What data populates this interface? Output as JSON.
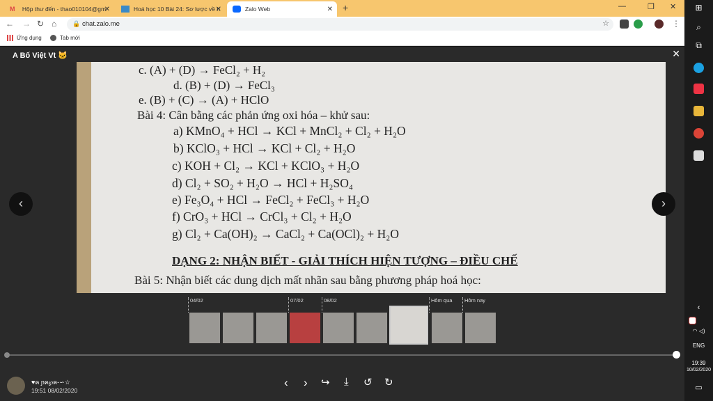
{
  "browser": {
    "tabs": [
      {
        "title": "Hộp thư đến - thao010104@gm:",
        "favicon": "gmail-icon"
      },
      {
        "title": "Hoá học 10 Bài 24: Sơ lược về hợ",
        "favicon": "edu-icon"
      },
      {
        "title": "Zalo Web",
        "favicon": "zalo-icon"
      }
    ],
    "url": "chat.zalo.me",
    "bookmarks": [
      {
        "label": "Ứng dụng",
        "icon": "apps-grid-icon"
      },
      {
        "label": "Tab mới",
        "icon": "globe-icon"
      }
    ]
  },
  "viewer": {
    "title": "A Bố Việt Vt 🐱",
    "photo_lines": [
      "c. (A) + (D) → FeCl₂ + H₂",
      "d. (B) + (D) → FeCl₃",
      "e. (B) + (C) → (A) + HClO",
      "Bài 4: Cân bằng các phản ứng oxi hóa – khử sau:",
      "a)  KMnO₄  +  HCl  →  KCl  +  MnCl₂  +  Cl₂  +  H₂O",
      "b)  KClO₃  +  HCl  →  KCl  +  Cl₂  +  H₂O",
      "c)  KOH  +  Cl₂  →  KCl  +  KClO₃  +  H₂O",
      "d)  Cl₂  + SO₂  +  H₂O →  HCl  +  H₂SO₄",
      "e)  Fe₃O₄  +  HCl  →  FeCl₂  +  FeCl₃  +  H₂O",
      "f)   CrO₃  +  HCl  →  CrCl₃  +  Cl₂  +  H₂O",
      "g)  Cl₂  +  Ca(OH)₂  →  CaCl₂  +  Ca(OCl)₂  +  H₂O",
      "DẠNG 2: NHẬN BIẾT - GIẢI THÍCH HIỆN TƯỢNG – ĐIỀU CHẾ",
      "Bài 5: Nhận biết các dung dịch mất nhãn sau bằng phương pháp hoá học:"
    ],
    "thumb_dates": [
      "04/02",
      "07/02",
      "08/02",
      "Hôm qua",
      "Hôm nay"
    ],
    "sender_name": "♥ค ɲค℘ค-∽☆",
    "sender_time": "19:51 08/02/2020"
  },
  "taskbar": {
    "lang": "ENG",
    "time": "19:39",
    "date": "10/02/2020"
  }
}
